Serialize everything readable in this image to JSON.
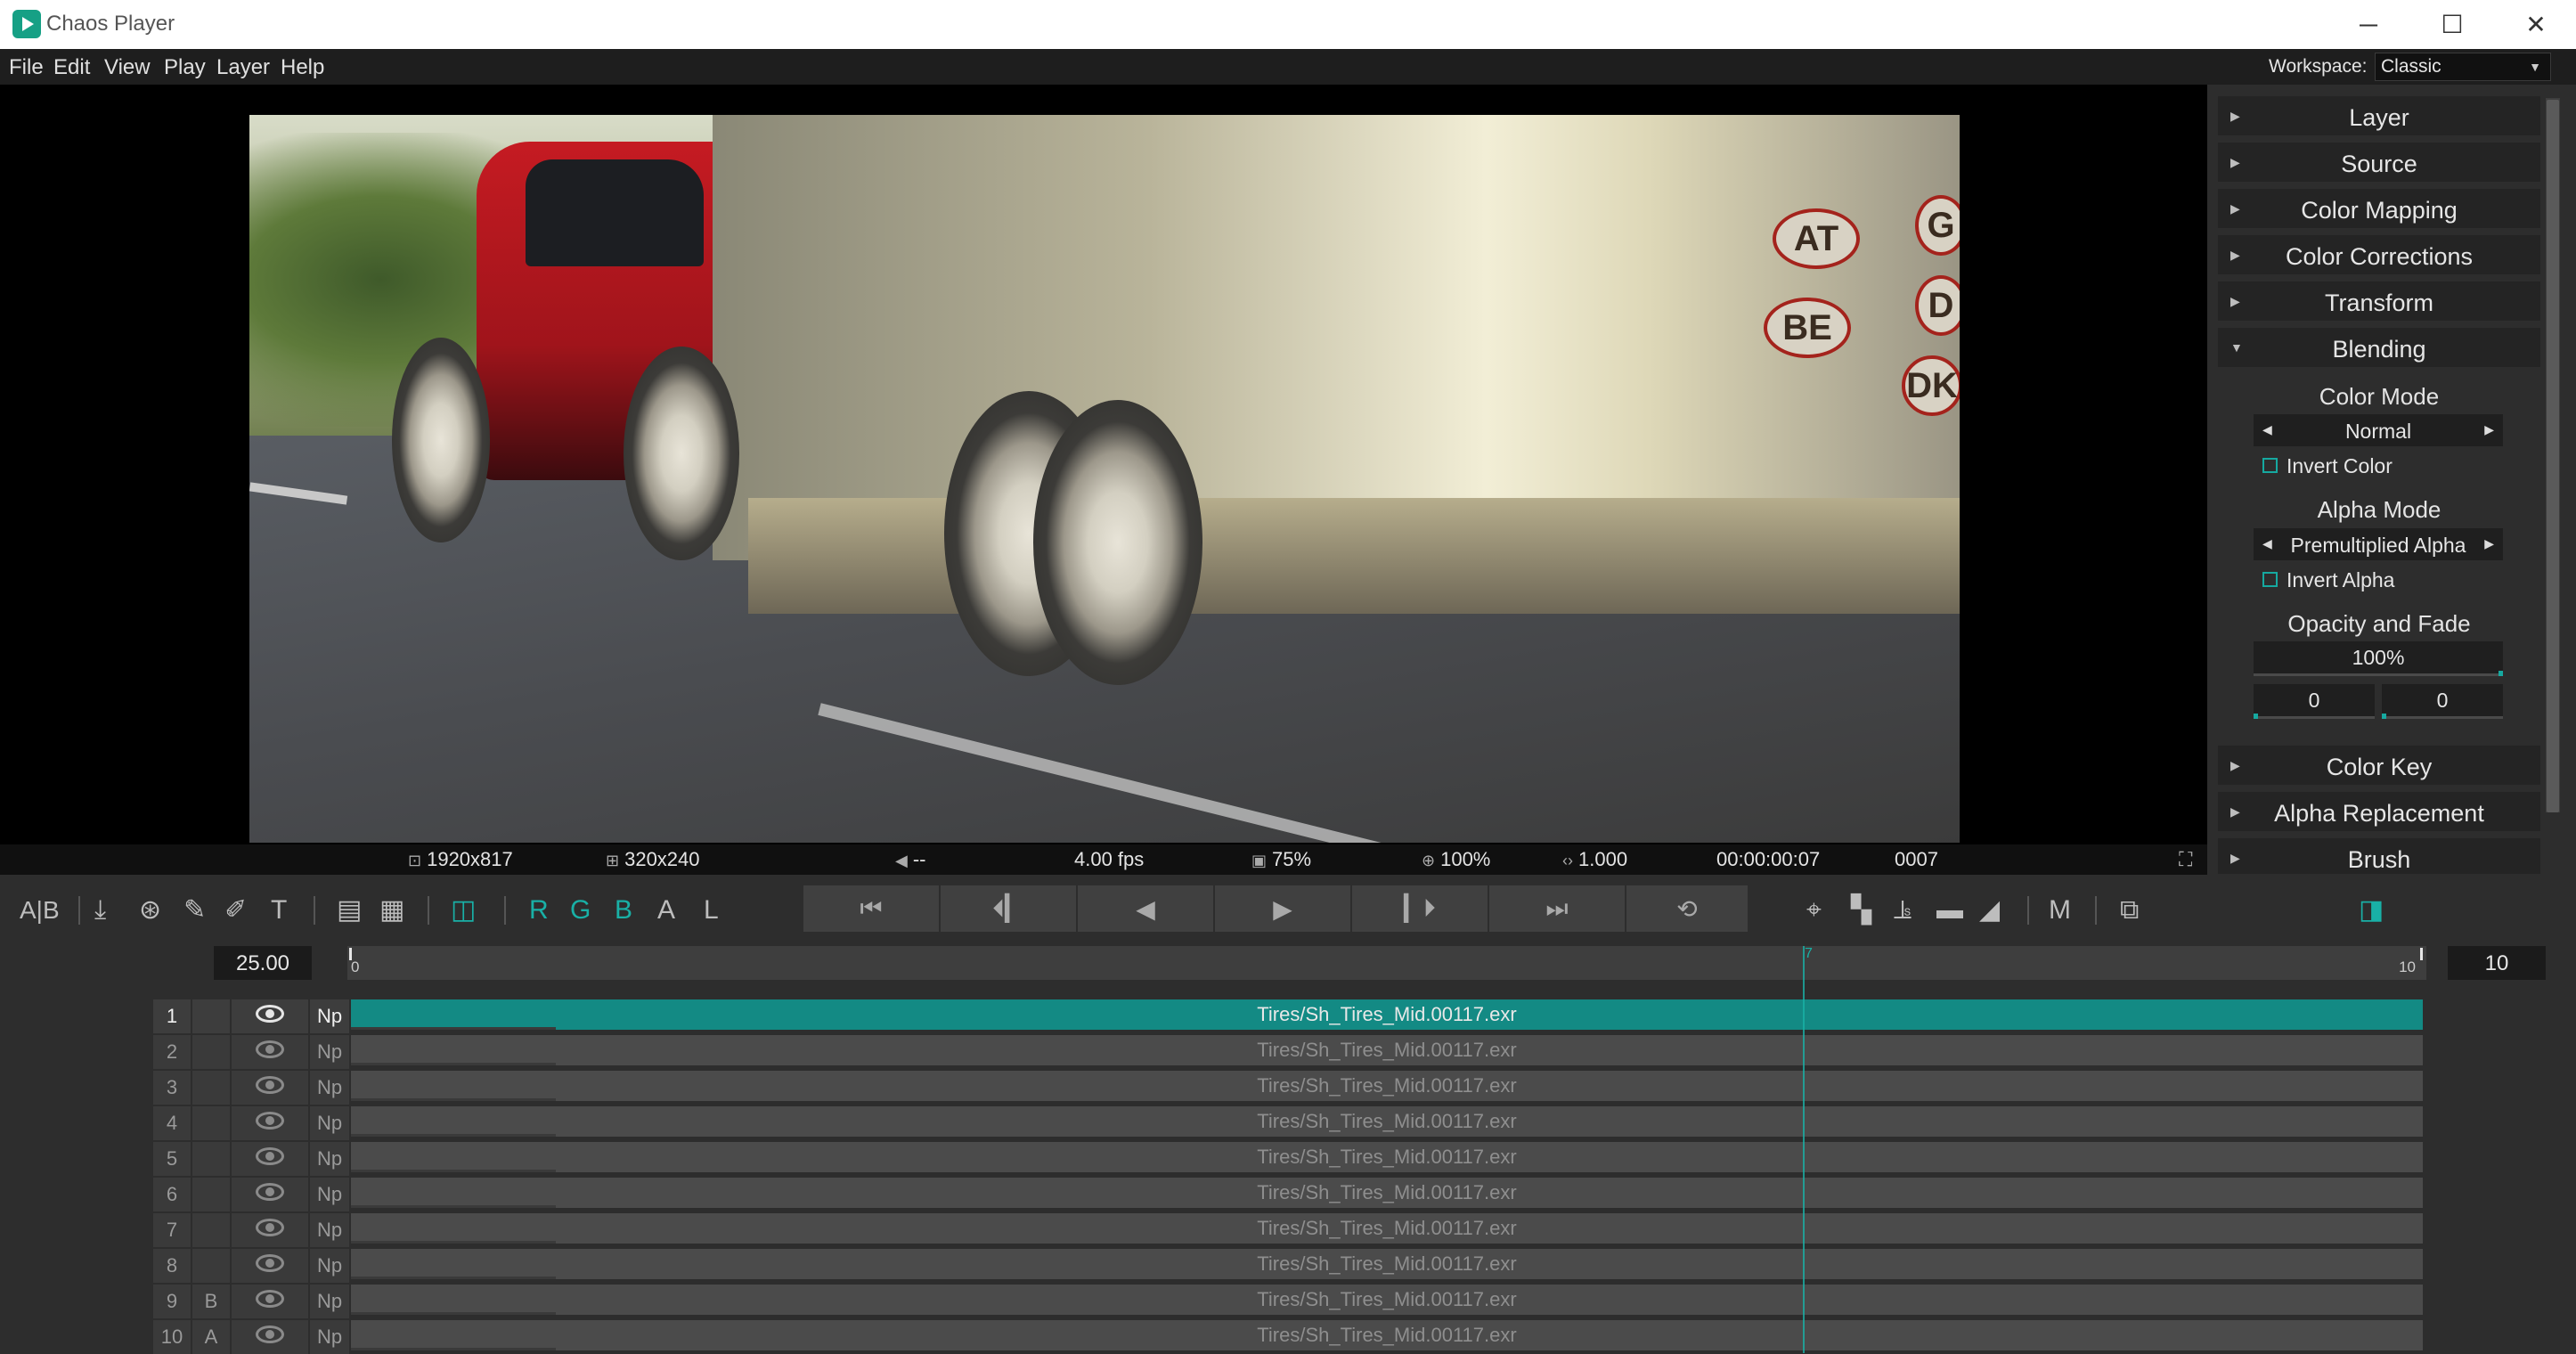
{
  "window": {
    "title": "Chaos Player",
    "controls": {
      "minimize": "─",
      "maximize": "☐",
      "close": "✕"
    }
  },
  "menu": {
    "items": [
      "File",
      "Edit",
      "View",
      "Play",
      "Layer",
      "Help"
    ],
    "workspace_label": "Workspace:",
    "workspace_value": "Classic"
  },
  "viewer_status": {
    "resolution": "1920x817",
    "proxy": "320x240",
    "audio": "--",
    "fps": "4.00 fps",
    "quality": "75%",
    "zoom": "100%",
    "speed": "1.000",
    "timecode": "00:00:00:07",
    "frame": "0007"
  },
  "frame_image": {
    "stickers": [
      "AT",
      "BE",
      "G",
      "D",
      "DK"
    ]
  },
  "properties": {
    "sections_top": [
      "Layer",
      "Source",
      "Color Mapping",
      "Color Corrections",
      "Transform",
      "Blending"
    ],
    "blending": {
      "color_mode_label": "Color Mode",
      "color_mode_value": "Normal",
      "invert_color": "Invert Color",
      "alpha_mode_label": "Alpha Mode",
      "alpha_mode_value": "Premultiplied Alpha",
      "invert_alpha": "Invert Alpha",
      "opacity_label": "Opacity and Fade",
      "opacity_value": "100%",
      "fade_in": "0",
      "fade_out": "0"
    },
    "sections_bottom": [
      "Color Key",
      "Alpha Replacement",
      "Brush"
    ]
  },
  "toolbar": {
    "ab_label": "A|B",
    "text_tool": "T",
    "channels": [
      "R",
      "G",
      "B",
      "A",
      "L"
    ],
    "m_label": "M"
  },
  "timeline": {
    "fps": "25.00",
    "ruler_start": "0",
    "ruler_end": "10",
    "ruler_current": "7",
    "end_frame": "10"
  },
  "layers": [
    {
      "num": "1",
      "ab": "",
      "np": "Np",
      "clip": "Tires/Sh_Tires_Mid.00117.exr"
    },
    {
      "num": "2",
      "ab": "",
      "np": "Np",
      "clip": "Tires/Sh_Tires_Mid.00117.exr"
    },
    {
      "num": "3",
      "ab": "",
      "np": "Np",
      "clip": "Tires/Sh_Tires_Mid.00117.exr"
    },
    {
      "num": "4",
      "ab": "",
      "np": "Np",
      "clip": "Tires/Sh_Tires_Mid.00117.exr"
    },
    {
      "num": "5",
      "ab": "",
      "np": "Np",
      "clip": "Tires/Sh_Tires_Mid.00117.exr"
    },
    {
      "num": "6",
      "ab": "",
      "np": "Np",
      "clip": "Tires/Sh_Tires_Mid.00117.exr"
    },
    {
      "num": "7",
      "ab": "",
      "np": "Np",
      "clip": "Tires/Sh_Tires_Mid.00117.exr"
    },
    {
      "num": "8",
      "ab": "",
      "np": "Np",
      "clip": "Tires/Sh_Tires_Mid.00117.exr"
    },
    {
      "num": "9",
      "ab": "B",
      "np": "Np",
      "clip": "Tires/Sh_Tires_Mid.00117.exr"
    },
    {
      "num": "10",
      "ab": "A",
      "np": "Np",
      "clip": "Tires/Sh_Tires_Mid.00117.exr"
    }
  ],
  "colors": {
    "accent": "#19b0a6",
    "active_clip": "#138a84",
    "panel": "#2d2d2d",
    "viewer_bg": "#000000"
  }
}
